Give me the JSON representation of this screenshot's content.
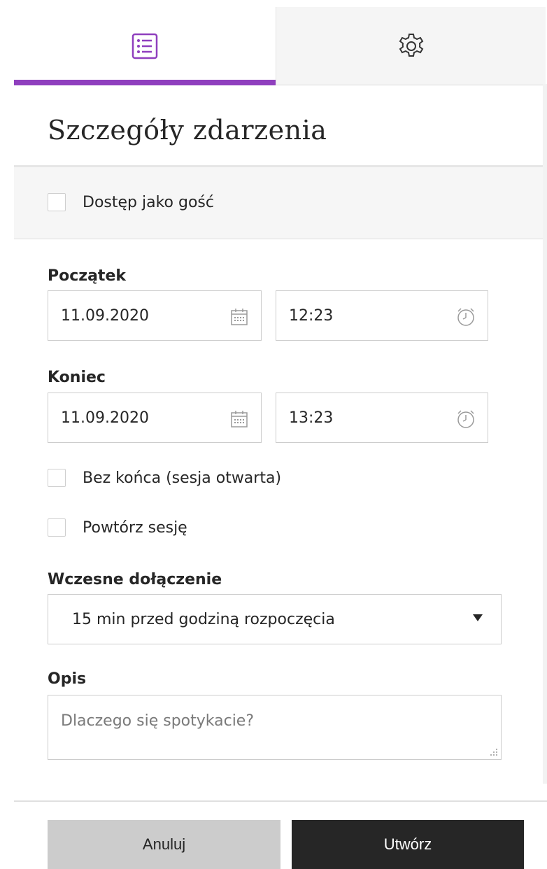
{
  "tabs": [
    {
      "label": "Szczegóły zdarzenia",
      "icon": "list-icon",
      "active": true
    },
    {
      "label": "Ustawienia",
      "icon": "gear-icon",
      "active": false
    }
  ],
  "accent_color": "#8f3fbe",
  "title": "Szczegóły zdarzenia",
  "guest_access": {
    "label": "Dostęp jako gość",
    "checked": false
  },
  "start": {
    "label": "Początek",
    "date": "11.09.2020",
    "time": "12:23",
    "date_icon": "calendar-icon",
    "time_icon": "clock-icon"
  },
  "end": {
    "label": "Koniec",
    "date": "11.09.2020",
    "time": "13:23",
    "date_icon": "calendar-icon",
    "time_icon": "clock-icon"
  },
  "open_session": {
    "label": "Bez końca (sesja otwarta)",
    "checked": false
  },
  "repeat_session": {
    "label": "Powtórz sesję",
    "checked": false
  },
  "early_join": {
    "label": "Wczesne dołączenie",
    "selected": "15 min przed godziną rozpoczęcia"
  },
  "description": {
    "label": "Opis",
    "placeholder": "Dlaczego się spotykacie?",
    "value": ""
  },
  "buttons": {
    "cancel": "Anuluj",
    "create": "Utwórz"
  }
}
